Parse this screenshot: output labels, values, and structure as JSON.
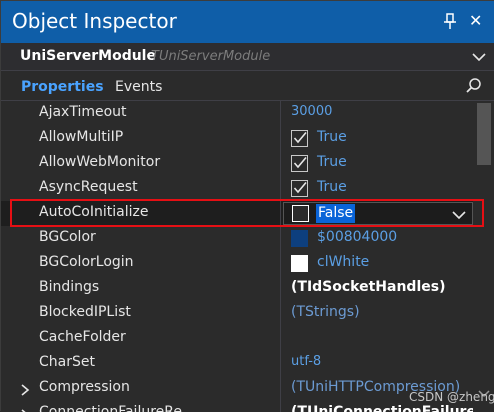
{
  "window": {
    "title": "Object Inspector",
    "close_glyph": "✕"
  },
  "object_selector": {
    "name": "UniServerModule",
    "type": "TUniServerModule"
  },
  "tabs": [
    {
      "label": "Properties"
    },
    {
      "label": "Events"
    }
  ],
  "properties": [
    {
      "name": "AjaxTimeout",
      "value": "30000"
    },
    {
      "name": "AllowMultiIP",
      "value": "True",
      "checked": true
    },
    {
      "name": "AllowWebMonitor",
      "value": "True",
      "checked": true
    },
    {
      "name": "AsyncRequest",
      "value": "True",
      "checked": true
    },
    {
      "name": "AutoCoInitialize",
      "value": "False",
      "checked": false
    },
    {
      "name": "BGColor",
      "value": "$00804000",
      "swatch": "#0d3f7e"
    },
    {
      "name": "BGColorLogin",
      "value": "clWhite",
      "swatch": "#ffffff"
    },
    {
      "name": "Bindings",
      "value": "(TIdSocketHandles)"
    },
    {
      "name": "BlockedIPList",
      "value": "(TStrings)"
    },
    {
      "name": "CacheFolder",
      "value": ""
    },
    {
      "name": "CharSet",
      "value": "utf-8"
    },
    {
      "name": "Compression",
      "value": "(TUniHTTPCompression)"
    },
    {
      "name": "ConnectionFailureRe",
      "value": "(TUniConnectionFailureRe"
    }
  ],
  "colors": {
    "accent": "#0f5ea8",
    "highlight_box": "#e60f14",
    "value_text": "#5b9fe4"
  },
  "watermark": "CSDN @zheng"
}
